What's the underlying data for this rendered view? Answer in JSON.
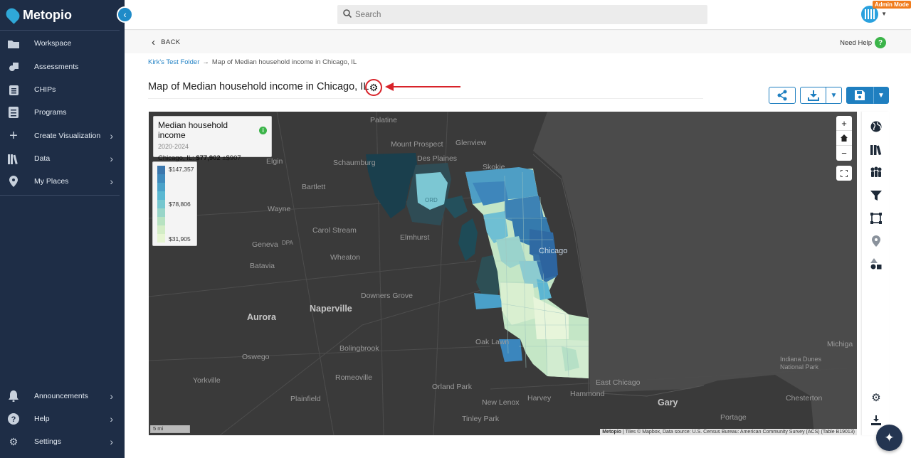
{
  "app": {
    "name": "Metopio",
    "admin_badge": "Admin Mode"
  },
  "sidebar": {
    "items": [
      {
        "label": "Workspace",
        "icon": "folder-icon"
      },
      {
        "label": "Assessments",
        "icon": "assessment-icon"
      },
      {
        "label": "CHIPs",
        "icon": "clipboard-icon"
      },
      {
        "label": "Programs",
        "icon": "programs-icon"
      },
      {
        "label": "Create Visualization",
        "icon": "plus-icon"
      },
      {
        "label": "Data",
        "icon": "books-icon"
      },
      {
        "label": "My Places",
        "icon": "map-pin-icon"
      },
      {
        "label": "Announcements",
        "icon": "bell-icon"
      },
      {
        "label": "Help",
        "icon": "question-icon"
      },
      {
        "label": "Settings",
        "icon": "gear-icon"
      }
    ]
  },
  "topbar": {
    "search_placeholder": "Search"
  },
  "subbar": {
    "back_label": "BACK",
    "help_label": "Need Help"
  },
  "breadcrumb": {
    "folder": "Kirk's Test Folder",
    "separator": "→",
    "current": "Map of Median household income in Chicago, IL"
  },
  "page": {
    "title": "Map of Median household income in Chicago, IL"
  },
  "map": {
    "legend": {
      "title": "Median household income",
      "years": "2020-2024",
      "place_label": "Chicago, IL:",
      "place_value": "$77,902",
      "place_moe": "±$907",
      "max_label": "$147,357",
      "mid_label": "$78,806",
      "min_label": "$31,905",
      "colors": [
        "#3b77ad",
        "#3f8bbd",
        "#4aa2c9",
        "#5ab8d2",
        "#76c7cf",
        "#98d5c8",
        "#b7e2c1",
        "#d3edc6",
        "#e6f5d2"
      ]
    },
    "zoom_in": "+",
    "zoom_out": "−",
    "scale_label": "5 mi",
    "attribution_brand": "Metopio",
    "attribution_text": " | Tiles © Mapbox, Data source: U.S. Census Bureau: American Community Survey (ACS) (Table B19013)",
    "places": {
      "palatine": "Palatine",
      "mount_prospect": "Mount Prospect",
      "glenview": "Glenview",
      "des_plaines": "Des Plaines",
      "schaumburg": "Schaumburg",
      "skokie": "Skokie",
      "elgin": "Elgin",
      "bartlett": "Bartlett",
      "wayne": "Wayne",
      "carol_stream": "Carol Stream",
      "elmhurst": "Elmhurst",
      "geneva": "Geneva",
      "dpa": "DPA",
      "wheaton": "Wheaton",
      "batavia": "Batavia",
      "downers_grove": "Downers Grove",
      "aurora": "Aurora",
      "naperville": "Naperville",
      "oak_lawn": "Oak Lawn",
      "bolingbrook": "Bolingbrook",
      "oswego": "Oswego",
      "romeoville": "Romeoville",
      "yorkville": "Yorkville",
      "orland_park": "Orland Park",
      "plainfield": "Plainfield",
      "harvey": "Harvey",
      "new_lenox": "New Lenox",
      "hammond": "Hammond",
      "east_chicago": "East Chicago",
      "gary": "Gary",
      "tinley_park": "Tinley Park",
      "indiana_dunes": "Indiana Dunes National Park",
      "chesterton": "Chesterton",
      "portage": "Portage",
      "michigan": "Michiga",
      "chicago": "Chicago",
      "ord": "ORD"
    }
  }
}
